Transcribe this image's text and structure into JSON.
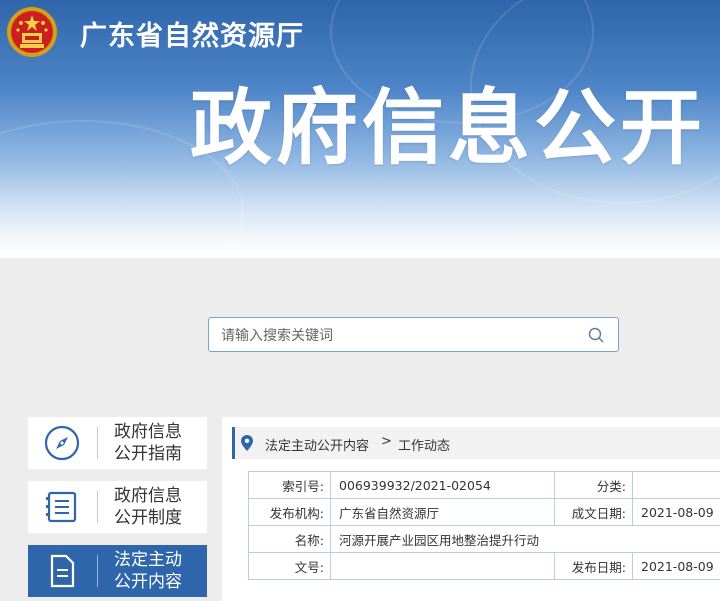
{
  "header": {
    "site_name": "广东省自然资源厅",
    "page_title": "政府信息公开"
  },
  "search": {
    "placeholder": "请输入搜索关键词",
    "icon": "search-icon"
  },
  "sidebar": {
    "items": [
      {
        "line1": "政府信息",
        "line2": "公开指南",
        "icon": "compass-icon",
        "active": false
      },
      {
        "line1": "政府信息",
        "line2": "公开制度",
        "icon": "document-list-icon",
        "active": false
      },
      {
        "line1": "法定主动",
        "line2": "公开内容",
        "icon": "file-icon",
        "active": true
      }
    ]
  },
  "breadcrumb": {
    "level1": "法定主动公开内容",
    "separator": ">",
    "level2": "工作动态"
  },
  "meta": {
    "index_label": "索引号:",
    "index_value": "006939932/2021-02054",
    "category_label": "分类:",
    "category_value": "",
    "publisher_label": "发布机构:",
    "publisher_value": "广东省自然资源厅",
    "created_label": "成文日期:",
    "created_value": "2021-08-09",
    "name_label": "名称:",
    "name_value": "河源开展产业园区用地整治提升行动",
    "docno_label": "文号:",
    "docno_value": "",
    "pubdate_label": "发布日期:",
    "pubdate_value": "2021-08-09"
  },
  "colors": {
    "primary": "#2f66ab",
    "border": "#b7cde6",
    "background": "#ededed"
  }
}
